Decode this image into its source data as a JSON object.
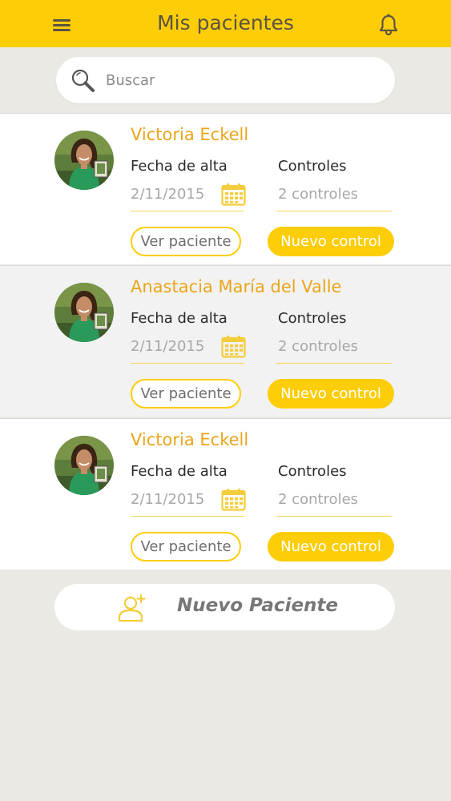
{
  "header": {
    "title": "Mis pacientes",
    "menu_icon": "hamburger-menu-icon",
    "bell_icon": "bell-icon",
    "color": "#fdcd08"
  },
  "search": {
    "placeholder": "Buscar",
    "icon": "search-icon"
  },
  "patients": [
    {
      "name": "Victoria Eckell",
      "fecha_label": "Fecha de alta",
      "fecha_value": "2/11/2015",
      "controles_label": "Controles",
      "controles_value": "2 controles",
      "ver_button": "Ver paciente",
      "nuevo_button": "Nuevo control"
    },
    {
      "name": "Anastacia María del Valle",
      "fecha_label": "Fecha de alta",
      "fecha_value": "2/11/2015",
      "controles_label": "Controles",
      "controles_value": "2 controles",
      "ver_button": "Ver paciente",
      "nuevo_button": "Nuevo control"
    },
    {
      "name": "Victoria Eckell",
      "fecha_label": "Fecha de alta",
      "fecha_value": "2/11/2015",
      "controles_label": "Controles",
      "controles_value": "2 controles",
      "ver_button": "Ver paciente",
      "nuevo_button": "Nuevo control"
    }
  ],
  "new_patient_button": {
    "label": "Nuevo Paciente",
    "icon": "add-user-icon"
  },
  "colors": {
    "accent": "#fdcd08",
    "name_color": "#eaa51a",
    "background": "#ebe9e4"
  }
}
